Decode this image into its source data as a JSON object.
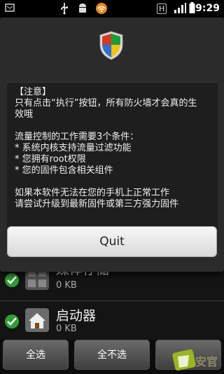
{
  "status_bar": {
    "time": "19:29",
    "network_indicator": "H",
    "icons": [
      "usb-icon",
      "android-debug-icon",
      "wifi-icon",
      "network-h-icon",
      "signal-icon",
      "battery-icon"
    ]
  },
  "dialog": {
    "icon": "shield-icon",
    "message_lines": [
      "【注意】",
      "只有点击“执行”按钮，所有防火墙才会真的生",
      "效哦",
      "",
      "流量控制的工作需要3个条件：",
      "* 系统内核支持流量过滤功能",
      "* 您拥有root权限",
      "* 您的固件包含相关组件",
      "",
      "如果本软件无法在您的手机上正常工作",
      "请尝试升级到最新固件或第三方强力固件"
    ],
    "quit_label": "Quit"
  },
  "app_list": {
    "items": [
      {
        "name": "媒体存储",
        "size": "0 KB",
        "checked": true
      },
      {
        "name": "启动器",
        "size": "0 KB",
        "checked": true
      }
    ]
  },
  "bottom_bar": {
    "select_all_label": "全选",
    "select_none_label": "全不选"
  },
  "watermark": {
    "text": "安官"
  },
  "colors": {
    "dialog_bg": "#2b2b2b",
    "check_green": "#2e9e35",
    "quit_button": "#e8e8e8"
  }
}
